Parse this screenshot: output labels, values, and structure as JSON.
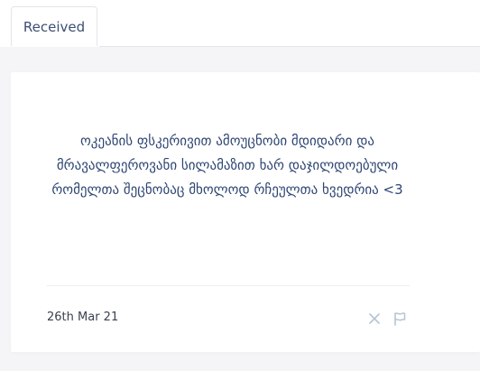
{
  "tabs": [
    {
      "label": "Received"
    }
  ],
  "message": {
    "text": "ოკეანის ფსკერივით ამოუცნობი მდიდარი და მრავალფეროვანი სილამაზით ხარ დაჯილდოებული რომელთა შეცნობაც მხოლოდ რჩეულთა ხვედრია <3",
    "date": "26th Mar 21"
  },
  "actions": {
    "dismiss_icon": "close-icon",
    "report_icon": "flag-icon"
  },
  "colors": {
    "accent": "#3d4f73",
    "message_text": "#2e4673",
    "icon": "#b5c4d6"
  }
}
